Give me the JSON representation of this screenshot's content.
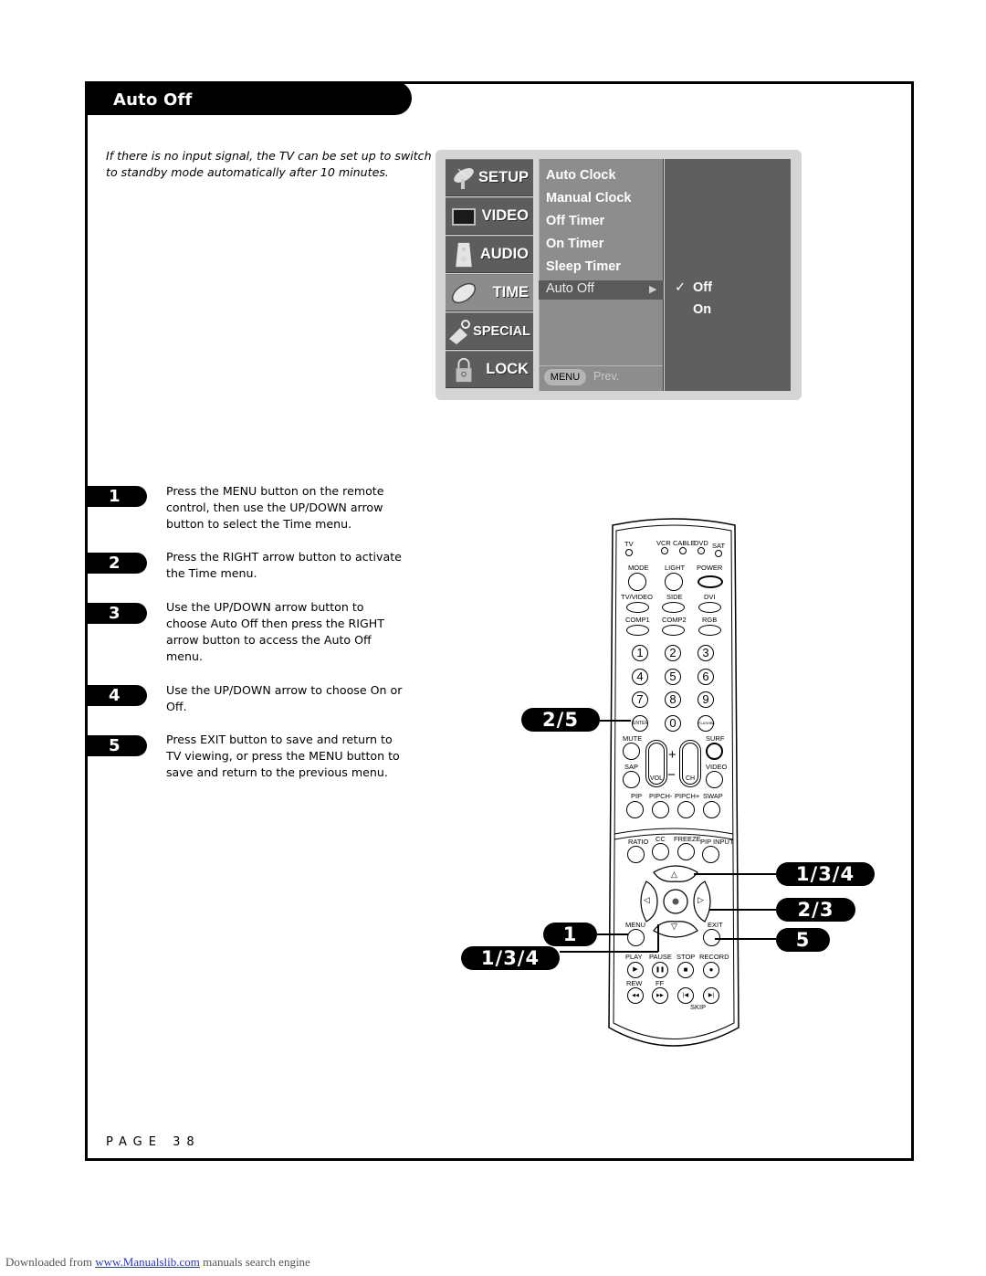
{
  "header": {
    "title": "Auto Off"
  },
  "intro": "If there is no input signal, the TV can be set up to switch to standby mode automatically after 10 minutes.",
  "osd": {
    "categories": [
      {
        "label": "SETUP",
        "icon": "satellite-dish-icon",
        "active": false
      },
      {
        "label": "VIDEO",
        "icon": "tv-screen-icon",
        "active": false
      },
      {
        "label": "AUDIO",
        "icon": "speaker-icon",
        "active": false
      },
      {
        "label": "TIME",
        "icon": "clock-disc-icon",
        "active": true
      },
      {
        "label": "SPECIAL",
        "icon": "tag-icon",
        "active": false
      },
      {
        "label": "LOCK",
        "icon": "padlock-icon",
        "active": false
      }
    ],
    "items": [
      "Auto Clock",
      "Manual Clock",
      "Off Timer",
      "On Timer",
      "Sleep Timer",
      "Auto Off"
    ],
    "selected_item": "Auto Off",
    "arrow": "▶",
    "options": [
      {
        "label": "Off",
        "checked": true
      },
      {
        "label": "On",
        "checked": false
      }
    ],
    "check": "✓",
    "footer": {
      "button": "MENU",
      "label": "Prev."
    },
    "colors": {
      "frame": "#d4d4d4",
      "category_bg": "#5d5d5d",
      "active_bg": "#8c8c8c",
      "submenu_bg": "#8d8d8d",
      "options_bg": "#5f5f5f"
    }
  },
  "steps": [
    {
      "number": "1",
      "text": "Press the MENU button on the remote control, then use the UP/DOWN arrow button to select the Time menu."
    },
    {
      "number": "2",
      "text": "Press the RIGHT arrow button to activate the Time menu."
    },
    {
      "number": "3",
      "text": "Use the UP/DOWN arrow button to choose Auto Off then press the RIGHT arrow button to access the Auto Off menu."
    },
    {
      "number": "4",
      "text": "Use the UP/DOWN arrow to choose On or Off."
    },
    {
      "number": "5",
      "text": "Press EXIT button to save and return to TV viewing, or press the MENU button to save and return to the previous menu."
    }
  ],
  "callouts": {
    "enter": "2/5",
    "up": "1/3/4",
    "right": "2/3",
    "exit": "5",
    "menu": "1",
    "down": "1/3/4"
  },
  "remote": {
    "modes": [
      "TV",
      "VCR",
      "CABLE",
      "DVD",
      "SAT"
    ],
    "row1": [
      "MODE",
      "LIGHT",
      "POWER"
    ],
    "row2": [
      "TV/VIDEO",
      "SIDE",
      "DVI"
    ],
    "row3": [
      "COMP1",
      "COMP2",
      "RGB"
    ],
    "digits": [
      "1",
      "2",
      "3",
      "4",
      "5",
      "6",
      "7",
      "8",
      "9"
    ],
    "enter": "ENTER",
    "zero": "0",
    "flashbk": "FLASHBK",
    "mute": "MUTE",
    "surf": "SURF",
    "sap": "SAP",
    "video": "VIDEO",
    "vol": "VOL",
    "ch": "CH",
    "plus": "+",
    "minus": "−",
    "pip_row": [
      "PIP",
      "PIPCH-",
      "PIPCH+",
      "SWAP"
    ],
    "func_row": [
      "RATIO",
      "CC",
      "FREEZE",
      "PIP INPUT"
    ],
    "menu": "MENU",
    "exit": "EXIT",
    "transport_labels": [
      "PLAY",
      "PAUSE",
      "STOP",
      "RECORD"
    ],
    "transport_icons": [
      "▶",
      "❚❚",
      "■",
      "●"
    ],
    "seek_labels": [
      "REW",
      "FF"
    ],
    "seek_icons": [
      "◀◀",
      "▶▶",
      "|◀",
      "▶|"
    ],
    "skip": "SKIP",
    "nav": {
      "up": "△",
      "down": "▽",
      "left": "◁",
      "right": "▷",
      "ok": "◉"
    }
  },
  "page": {
    "label": "PAGE 38"
  },
  "footer": {
    "prefix": "Downloaded from ",
    "link": "www.Manualslib.com",
    "suffix": "  manuals search engine"
  }
}
